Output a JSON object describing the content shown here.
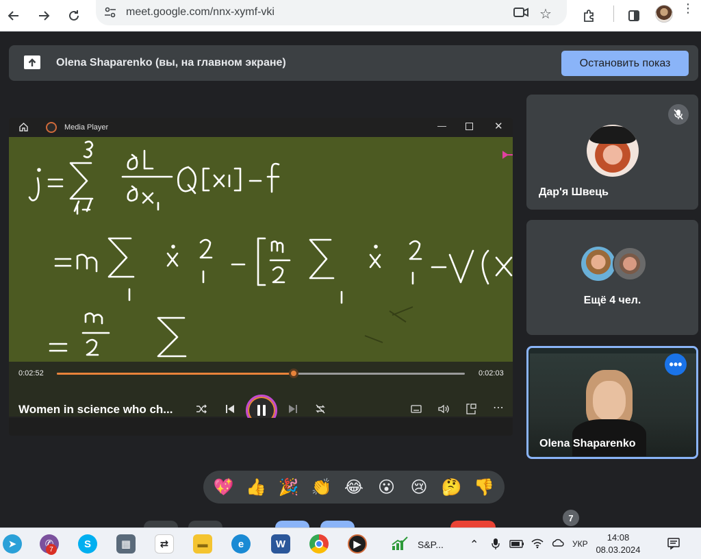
{
  "browser": {
    "url": "meet.google.com/nnx-xymf-vki"
  },
  "banner": {
    "title": "Olena Shaparenko (вы, на главном экране)",
    "stop_label": "Остановить показ"
  },
  "player": {
    "app_name": "Media Player",
    "time_elapsed": "0:02:52",
    "time_remaining": "0:02:03",
    "progress": 0.58,
    "video_title": "Women in science who ch...",
    "board_lines": [
      "j = Σ ∂L/∂ẋᵢ Q[xᵢ] − f",
      "= m Σ ẋᵢ² − [ m/2 Σ ẋᵢ² − V(x",
      "= m/2 Σ"
    ]
  },
  "tiles": {
    "tile1_name": "Дар'я Швець",
    "tile2_name": "Ещё 4 чел.",
    "tile3_name": "Olena Shaparenko"
  },
  "reactions": [
    "💖",
    "👍",
    "🎉",
    "👏",
    "😂",
    "😮",
    "😢",
    "🤔",
    "👎"
  ],
  "people_count": "7",
  "taskbar": {
    "viber_badge": "7",
    "sp_label": "S&P...",
    "lang": "УКР",
    "time": "14:08",
    "date": "08.03.2024"
  },
  "colors": {
    "meet_bg": "#202124",
    "tile_bg": "#3c4043",
    "accent_blue": "#8ab4f8",
    "board_green": "#4c5a22",
    "progress_orange": "#e8833a"
  }
}
